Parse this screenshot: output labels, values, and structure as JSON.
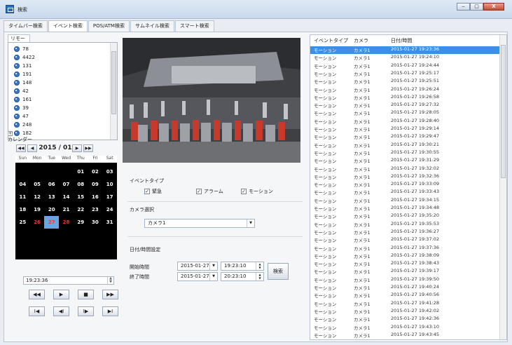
{
  "window": {
    "title": "検索",
    "buttons": {
      "minimize": "‒",
      "maximize": "▢",
      "close": "X"
    }
  },
  "tabs": [
    "タイムバー検索",
    "イベント検索",
    "POS/ATM検索",
    "サムネイル検索",
    "スマート検索"
  ],
  "active_tab": "イベント検索",
  "left": {
    "remote_tab": "リモート",
    "tree_items": [
      "78",
      "4422",
      "131",
      "191",
      "148",
      "42",
      "161",
      "39",
      "47",
      "248",
      "182"
    ],
    "calendar_label": "カレンダー",
    "month": "2015 / 01",
    "weekdays": [
      "Sun",
      "Mon",
      "Tue",
      "Wed",
      "Thu",
      "Fri",
      "Sat"
    ],
    "weeks": [
      [
        "",
        "",
        "",
        "",
        "01",
        "02",
        "03"
      ],
      [
        "04",
        "05",
        "06",
        "07",
        "08",
        "09",
        "10"
      ],
      [
        "11",
        "12",
        "13",
        "14",
        "15",
        "16",
        "17"
      ],
      [
        "18",
        "19",
        "20",
        "21",
        "22",
        "23",
        "24"
      ],
      [
        "25",
        "26",
        "27",
        "28",
        "29",
        "30",
        "31"
      ]
    ],
    "red_days": [
      "26",
      "28"
    ],
    "selected_day": "27",
    "current_time": "19:23:36",
    "controls_row1": [
      "◀◀",
      "▶",
      "■",
      "▶▶"
    ],
    "controls_row2": [
      "I◀",
      "◀I",
      "I▶",
      "▶I"
    ]
  },
  "center": {
    "event_type_label": "イベントタイプ",
    "event_types": [
      {
        "label": "緊急",
        "checked": true
      },
      {
        "label": "アラーム",
        "checked": true
      },
      {
        "label": "モーション",
        "checked": true
      }
    ],
    "camera_select_label": "カメラ選択",
    "camera_selected": "カメラ1",
    "datetime_label": "日付/時間設定",
    "start_label": "開始時間",
    "start_date": "2015-01-27",
    "start_time": "19:23:10",
    "end_label": "終了時間",
    "end_date": "2015-01-27",
    "end_time": "20:23:10",
    "search_button": "検索"
  },
  "event_list": {
    "columns": [
      "イベントタイプ",
      "カメラ",
      "日付/時間"
    ],
    "rows": [
      [
        "モーション",
        "カメラ1",
        "2015-01-27 19:23:36"
      ],
      [
        "モーション",
        "カメラ1",
        "2015-01-27 19:24:10"
      ],
      [
        "モーション",
        "カメラ1",
        "2015-01-27 19:24:44"
      ],
      [
        "モーション",
        "カメラ1",
        "2015-01-27 19:25:17"
      ],
      [
        "モーション",
        "カメラ1",
        "2015-01-27 19:25:51"
      ],
      [
        "モーション",
        "カメラ1",
        "2015-01-27 19:26:24"
      ],
      [
        "モーション",
        "カメラ1",
        "2015-01-27 19:26:58"
      ],
      [
        "モーション",
        "カメラ1",
        "2015-01-27 19:27:32"
      ],
      [
        "モーション",
        "カメラ1",
        "2015-01-27 19:28:05"
      ],
      [
        "モーション",
        "カメラ1",
        "2015-01-27 19:28:40"
      ],
      [
        "モーション",
        "カメラ1",
        "2015-01-27 19:29:14"
      ],
      [
        "モーション",
        "カメラ1",
        "2015-01-27 19:29:47"
      ],
      [
        "モーション",
        "カメラ1",
        "2015-01-27 19:30:21"
      ],
      [
        "モーション",
        "カメラ1",
        "2015-01-27 19:30:55"
      ],
      [
        "モーション",
        "カメラ1",
        "2015-01-27 19:31:29"
      ],
      [
        "モーション",
        "カメラ1",
        "2015-01-27 19:32:02"
      ],
      [
        "モーション",
        "カメラ1",
        "2015-01-27 19:32:36"
      ],
      [
        "モーション",
        "カメラ1",
        "2015-01-27 19:33:09"
      ],
      [
        "モーション",
        "カメラ1",
        "2015-01-27 19:33:43"
      ],
      [
        "モーション",
        "カメラ1",
        "2015-01-27 19:34:15"
      ],
      [
        "モーション",
        "カメラ1",
        "2015-01-27 19:34:48"
      ],
      [
        "モーション",
        "カメラ1",
        "2015-01-27 19:35:20"
      ],
      [
        "モーション",
        "カメラ1",
        "2015-01-27 19:35:53"
      ],
      [
        "モーション",
        "カメラ1",
        "2015-01-27 19:36:27"
      ],
      [
        "モーション",
        "カメラ1",
        "2015-01-27 19:37:02"
      ],
      [
        "モーション",
        "カメラ1",
        "2015-01-27 19:37:36"
      ],
      [
        "モーション",
        "カメラ1",
        "2015-01-27 19:38:09"
      ],
      [
        "モーション",
        "カメラ1",
        "2015-01-27 19:38:43"
      ],
      [
        "モーション",
        "カメラ1",
        "2015-01-27 19:39:17"
      ],
      [
        "モーション",
        "カメラ1",
        "2015-01-27 19:39:50"
      ],
      [
        "モーション",
        "カメラ1",
        "2015-01-27 19:40:24"
      ],
      [
        "モーション",
        "カメラ1",
        "2015-01-27 19:40:56"
      ],
      [
        "モーション",
        "カメラ1",
        "2015-01-27 19:41:28"
      ],
      [
        "モーション",
        "カメラ1",
        "2015-01-27 19:42:02"
      ],
      [
        "モーション",
        "カメラ1",
        "2015-01-27 19:42:36"
      ],
      [
        "モーション",
        "カメラ1",
        "2015-01-27 19:43:10"
      ],
      [
        "モーション",
        "カメラ1",
        "2015-01-27 19:43:45"
      ]
    ],
    "selected_row": 0
  },
  "colors": {
    "selection": "#3d8ee6",
    "calendar_bg": "#000000",
    "calendar_selected": "#6aa5e2",
    "holiday_red": "#e23d2d"
  }
}
